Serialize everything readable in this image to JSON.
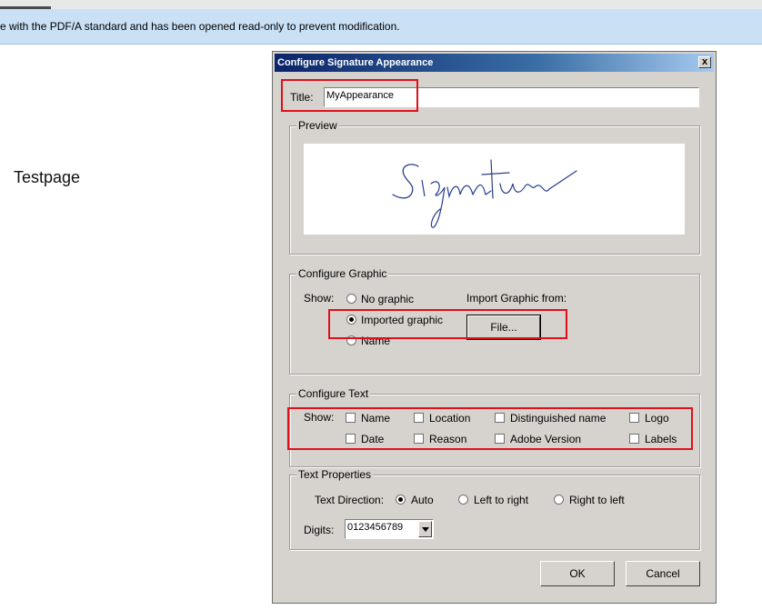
{
  "notification": {
    "text": "e with the PDF/A standard and has been opened read-only to prevent modification."
  },
  "page": {
    "label": "Testpage"
  },
  "dialog": {
    "title": "Configure Signature Appearance",
    "close_label": "x",
    "title_field": {
      "label": "Title:",
      "value": "MyAppearance"
    },
    "preview": {
      "legend": "Preview"
    },
    "configure_graphic": {
      "legend": "Configure Graphic",
      "show_label": "Show:",
      "options": [
        "No graphic",
        "Imported graphic",
        "Name"
      ],
      "selected": "Imported graphic",
      "import_label": "Import Graphic from:",
      "file_button": "File..."
    },
    "configure_text": {
      "legend": "Configure Text",
      "show_label": "Show:",
      "checkboxes": [
        "Name",
        "Location",
        "Distinguished name",
        "Logo",
        "Date",
        "Reason",
        "Adobe Version",
        "Labels"
      ]
    },
    "text_properties": {
      "legend": "Text Properties",
      "direction_label": "Text Direction:",
      "directions": [
        "Auto",
        "Left to right",
        "Right to left"
      ],
      "selected_direction": "Auto",
      "digits_label": "Digits:",
      "digits_value": "0123456789"
    },
    "ok_button": "OK",
    "cancel_button": "Cancel"
  },
  "colors": {
    "highlight": "#e0101a",
    "titlebar": "#0a246a",
    "notification_bg": "#c9e0f5"
  }
}
